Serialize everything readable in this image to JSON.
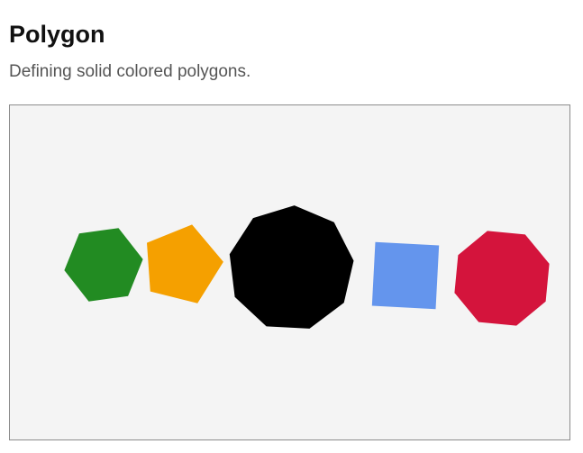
{
  "header": {
    "title": "Polygon",
    "subtitle": "Defining solid colored polygons."
  },
  "canvas": {
    "background": "#f4f4f4",
    "shapes": [
      {
        "name": "hexagon",
        "sides": 6,
        "color": "#228b22"
      },
      {
        "name": "pentagon",
        "sides": 5,
        "color": "#f5a000"
      },
      {
        "name": "nonagon",
        "sides": 9,
        "color": "#000000"
      },
      {
        "name": "square",
        "sides": 4,
        "color": "#6495ed"
      },
      {
        "name": "octagon",
        "sides": 8,
        "color": "#d4143c"
      }
    ]
  }
}
